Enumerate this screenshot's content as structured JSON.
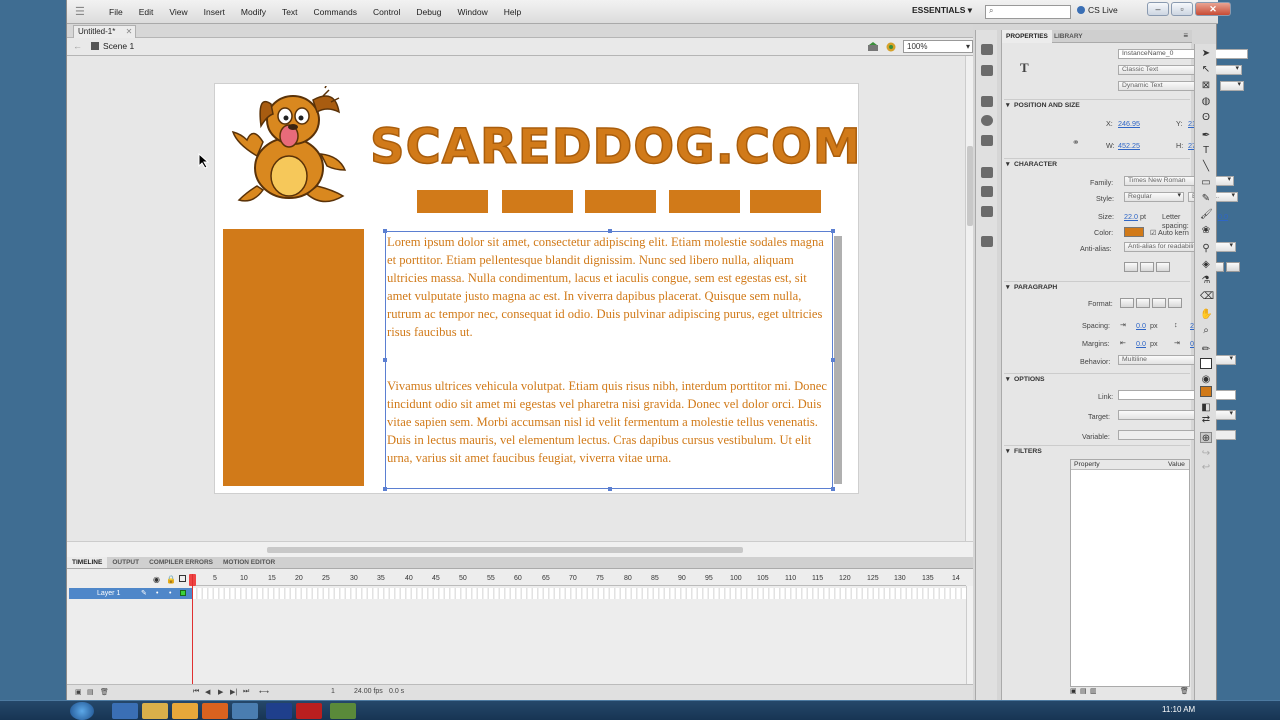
{
  "menu": [
    "File",
    "Edit",
    "View",
    "Insert",
    "Modify",
    "Text",
    "Commands",
    "Control",
    "Debug",
    "Window",
    "Help"
  ],
  "workspace": "ESSENTIALS",
  "cs_live": "CS Live",
  "document_tab": "Untitled-1*",
  "scene": "Scene 1",
  "zoom": "100%",
  "stage": {
    "logo": "SCAREDDOG.COM",
    "paragraph1": "Lorem ipsum dolor sit amet, consectetur adipiscing elit. Etiam molestie sodales magna et porttitor. Etiam pellentesque blandit dignissim. Nunc sed libero nulla, aliquam ultricies massa. Nulla condimentum, lacus et iaculis congue, sem est egestas est, sit amet vulputate justo magna ac est. In viverra dapibus placerat. Quisque sem nulla, rutrum ac tempor nec, consequat id odio. Duis pulvinar adipiscing purus, eget ultricies risus faucibus ut.",
    "paragraph2": "Vivamus ultrices vehicula volutpat. Etiam quis risus nibh, interdum porttitor mi. Donec tincidunt odio sit amet mi egestas vel pharetra nisi gravida. Donec vel dolor orci. Duis vitae sapien sem. Morbi accumsan nisl id velit fermentum a molestie tellus venenatis. Duis in lectus mauris, vel elementum lectus. Cras dapibus cursus vestibulum. Ut elit urna, varius sit amet faucibus feugiat, viverra vitae urna."
  },
  "timeline": {
    "tabs": [
      "TIMELINE",
      "OUTPUT",
      "COMPILER ERRORS",
      "MOTION EDITOR"
    ],
    "ticks": [
      "5",
      "10",
      "15",
      "20",
      "25",
      "30",
      "35",
      "40",
      "45",
      "50",
      "55",
      "60",
      "65",
      "70",
      "75",
      "80",
      "85",
      "90",
      "95",
      "100",
      "105",
      "110",
      "115",
      "120",
      "125",
      "130",
      "135",
      "14"
    ],
    "layer": "Layer 1",
    "current_frame": "1",
    "fps": "24.00 fps",
    "time": "0.0 s"
  },
  "properties": {
    "tabs": [
      "PROPERTIES",
      "LIBRARY"
    ],
    "instance_name": "InstanceName_0",
    "text_engine": "Classic Text",
    "text_type": "Dynamic Text",
    "position_section": "POSITION AND SIZE",
    "x_label": "X:",
    "x": "246.95",
    "y_label": "Y:",
    "y": "212.00",
    "w_label": "W:",
    "w": "452.25",
    "h_label": "H:",
    "h": "277.00",
    "character_section": "CHARACTER",
    "family_label": "Family:",
    "family": "Times New Roman",
    "style_label": "Style:",
    "style": "Regular",
    "embed": "Embed...",
    "size_label": "Size:",
    "size": "22.0",
    "size_unit": "pt",
    "letter_spacing_label": "Letter spacing:",
    "letter_spacing": "0.0",
    "color_label": "Color:",
    "auto_kern": "Auto kern",
    "antialias_label": "Anti-alias:",
    "antialias": "Anti-alias for readability",
    "paragraph_section": "PARAGRAPH",
    "format_label": "Format:",
    "spacing_label": "Spacing:",
    "spacing1": "0.0",
    "spacing1_unit": "px",
    "spacing2": "2.0",
    "spacing2_unit": "pt",
    "margins_label": "Margins:",
    "margin1": "0.0",
    "margin1_unit": "px",
    "margin2": "0.0",
    "margin2_unit": "px",
    "behavior_label": "Behavior:",
    "behavior": "Multiline",
    "options_section": "OPTIONS",
    "link_label": "Link:",
    "target_label": "Target:",
    "variable_label": "Variable:",
    "filters_section": "FILTERS",
    "filter_cols": [
      "Property",
      "Value"
    ]
  },
  "colors": {
    "brand_orange": "#d17a19",
    "selection_blue": "#5b7fd1"
  },
  "taskbar": {
    "clock": "11:10 AM"
  }
}
